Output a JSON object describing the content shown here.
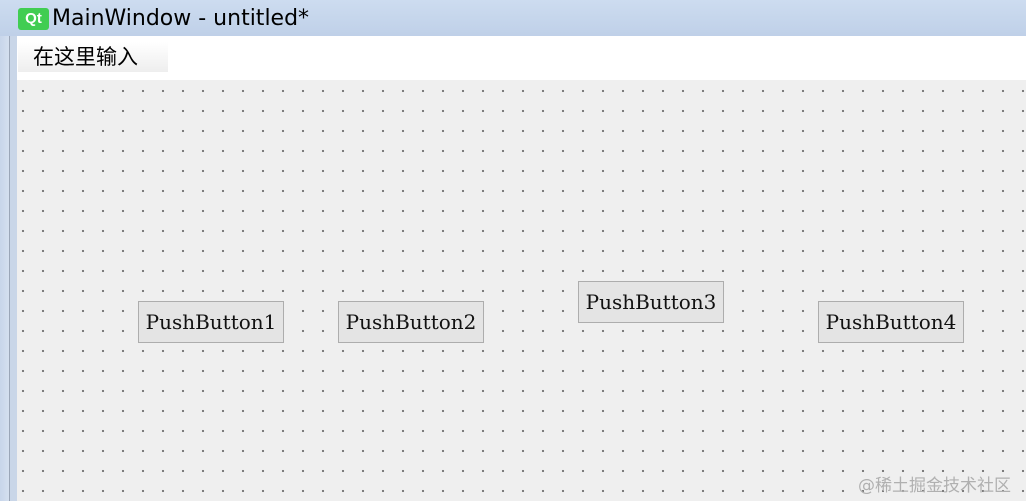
{
  "window": {
    "title": "MainWindow - untitled*",
    "logo_text": "Qt"
  },
  "menubar": {
    "entry_placeholder": "在这里输入"
  },
  "central": {
    "buttons": [
      {
        "label": "PushButton1"
      },
      {
        "label": "PushButton2"
      },
      {
        "label": "PushButton3"
      },
      {
        "label": "PushButton4"
      }
    ]
  },
  "watermark": {
    "text": "@稀土掘金技术社区"
  },
  "colors": {
    "titlebar": "#c9d6e8",
    "qt_green": "#41cd52",
    "canvas": "#efefef",
    "button_face": "#e4e4e4"
  }
}
